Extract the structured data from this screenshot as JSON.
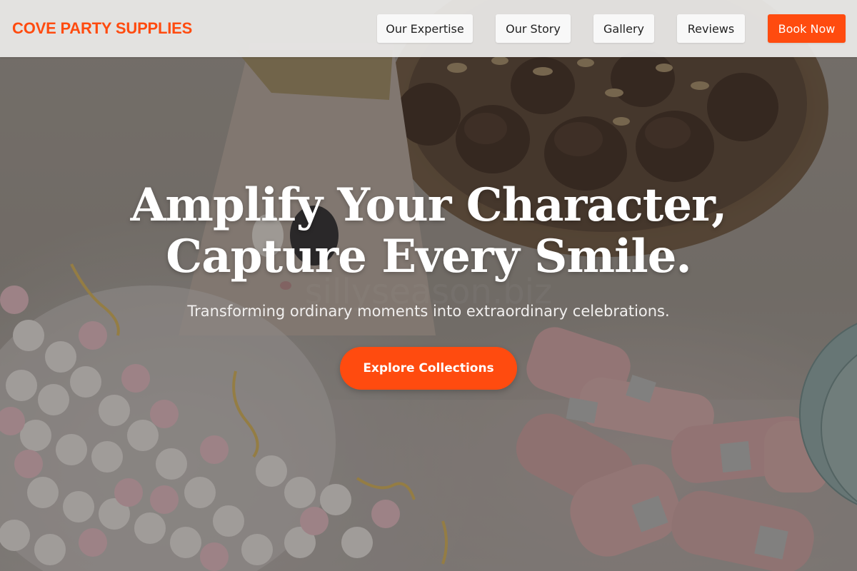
{
  "nav": {
    "brand": "COVE PARTY SUPPLIES",
    "items": [
      {
        "label": "Our Expertise"
      },
      {
        "label": "Our Story"
      },
      {
        "label": "Gallery"
      },
      {
        "label": "Reviews"
      }
    ],
    "cta_label": "Book Now"
  },
  "hero": {
    "headline_line1": "Amplify Your Character,",
    "headline_line2": "Capture Every Smile.",
    "subheadline": "Transforming ordinary moments into extraordinary celebrations.",
    "button_label": "Explore Collections",
    "background_image": "party-supplies-photo"
  },
  "colors": {
    "accent": "#ff4b0f",
    "nav_background": "#ecebea",
    "nav_button": "#f8f8f8",
    "hero_text": "#ffffff"
  }
}
